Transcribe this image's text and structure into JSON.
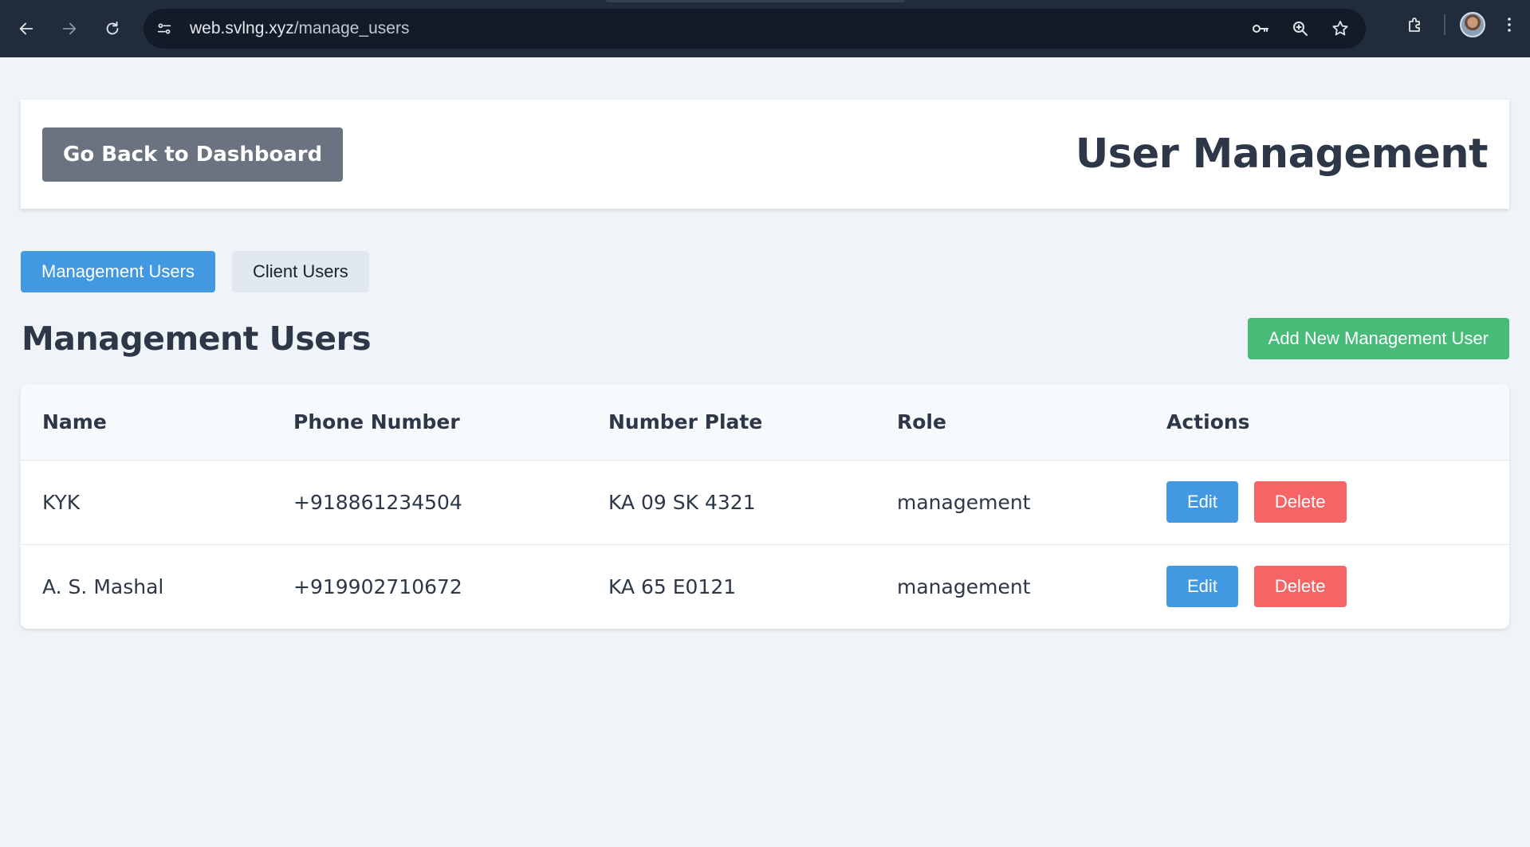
{
  "browser": {
    "url_host": "web.svlng.xyz",
    "url_path": "/manage_users",
    "icons": [
      "back-arrow-icon",
      "forward-arrow-icon",
      "reload-icon",
      "site-info-icon",
      "password-key-icon",
      "zoom-icon",
      "bookmark-star-icon",
      "extensions-icon",
      "profile-avatar",
      "more-menu-icon"
    ]
  },
  "header": {
    "back_label": "Go Back to Dashboard",
    "title": "User Management"
  },
  "tabs": [
    {
      "label": "Management Users",
      "active": true
    },
    {
      "label": "Client Users",
      "active": false
    }
  ],
  "section": {
    "title": "Management Users",
    "add_label": "Add New Management User"
  },
  "table": {
    "columns": [
      "Name",
      "Phone Number",
      "Number Plate",
      "Role",
      "Actions"
    ],
    "rows": [
      {
        "name": "KYK",
        "phone": "+918861234504",
        "plate": "KA 09 SK 4321",
        "role": "management",
        "edit": "Edit",
        "delete": "Delete"
      },
      {
        "name": "A. S. Mashal",
        "phone": "+919902710672",
        "plate": "KA 65 E0121",
        "role": "management",
        "edit": "Edit",
        "delete": "Delete"
      }
    ]
  },
  "colors": {
    "primary": "#4299e1",
    "success": "#48bb78",
    "danger": "#f56565",
    "secondary": "#6b7280",
    "chrome": "#202b3c"
  }
}
